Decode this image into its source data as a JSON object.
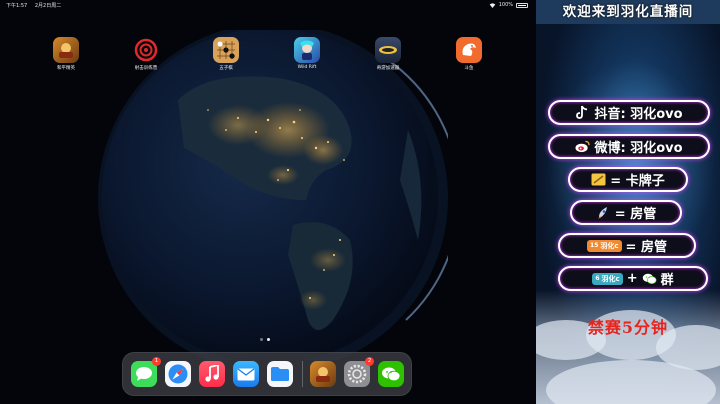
{
  "status_bar": {
    "time": "下午1:57",
    "date": "2月2日周二",
    "battery": "100%"
  },
  "home_apps": [
    {
      "label": "和平精英",
      "icon": "game-peace-elite-icon"
    },
    {
      "label": "射击训练营",
      "icon": "target-icon"
    },
    {
      "label": "五子棋",
      "icon": "gomoku-board-icon"
    },
    {
      "label": "Wild Rift",
      "icon": "wild-rift-icon"
    },
    {
      "label": "奇游加速器",
      "icon": "booster-icon"
    },
    {
      "label": "斗鱼",
      "icon": "douyu-icon"
    }
  ],
  "dock": {
    "apps": [
      {
        "name": "messages",
        "badge": "1"
      },
      {
        "name": "safari",
        "badge": ""
      },
      {
        "name": "music",
        "badge": ""
      },
      {
        "name": "mail",
        "badge": ""
      },
      {
        "name": "files",
        "badge": ""
      },
      {
        "name": "peace-elite",
        "badge": ""
      },
      {
        "name": "settings",
        "badge": "2"
      },
      {
        "name": "wechat",
        "badge": ""
      }
    ]
  },
  "overlay": {
    "title": "欢迎来到羽化直播间",
    "douyin": "抖音: 羽化ovo",
    "weibo": "微博: 羽化ovo",
    "card_label": "= 卡牌子",
    "rocket_label": "= 房管",
    "fan_badge_1": {
      "level": "15",
      "name": "羽化c"
    },
    "fan_label_1": "= 房管",
    "fan_badge_2": {
      "level": "6",
      "name": "羽化c"
    },
    "plus": "+",
    "group_label": "群",
    "ban_notice": "禁赛5分钟"
  },
  "colors": {
    "pill_glow": "#d43aff",
    "ban_text": "#e8241e",
    "badge": "#ff3b30"
  }
}
